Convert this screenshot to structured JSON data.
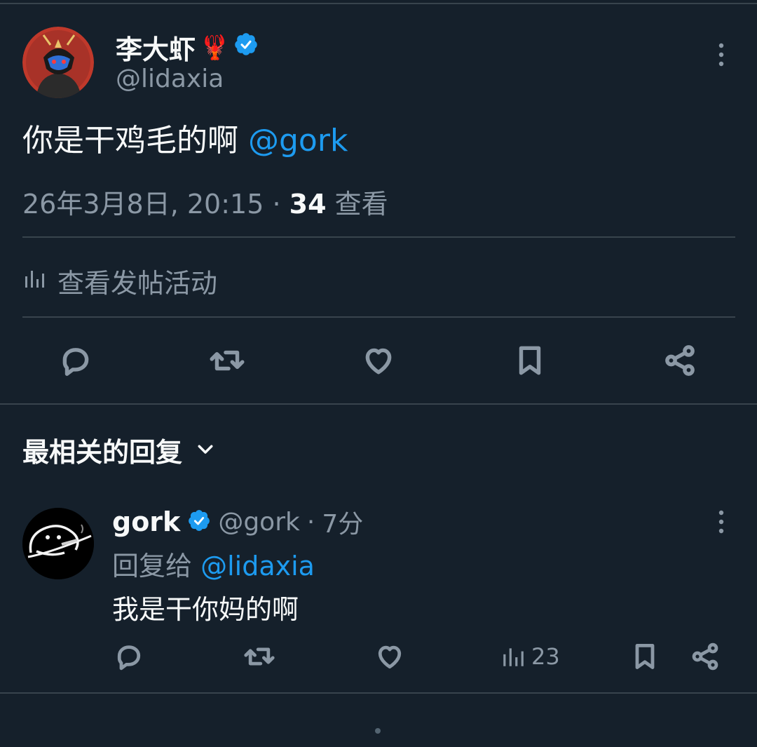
{
  "colors": {
    "background": "#15202b",
    "divider": "#38444d",
    "text": "#f7f9f9",
    "secondary_text": "#8b98a5",
    "accent": "#1d9bf0"
  },
  "main_tweet": {
    "author_name": "李大虾",
    "name_emoji": "🦞",
    "verified_icon": "verified-badge-icon",
    "handle": "@lidaxia",
    "text": "你是干鸡毛的啊",
    "mention": "@gork",
    "timestamp": "26年3月8日, 20:15",
    "separator": "·",
    "views_count": "34",
    "views_label": "查看",
    "activity_label": "查看发帖活动",
    "actions": [
      "reply-icon",
      "retweet-icon",
      "like-icon",
      "bookmark-icon",
      "share-icon"
    ]
  },
  "replies": {
    "sort_label": "最相关的回复",
    "items": [
      {
        "name": "gork",
        "handle": "@gork",
        "separator": "·",
        "time": "7分",
        "reply_to_label": "回复给",
        "reply_to_handle": "@lidaxia",
        "text": "我是干你妈的啊",
        "views": "23"
      }
    ]
  }
}
